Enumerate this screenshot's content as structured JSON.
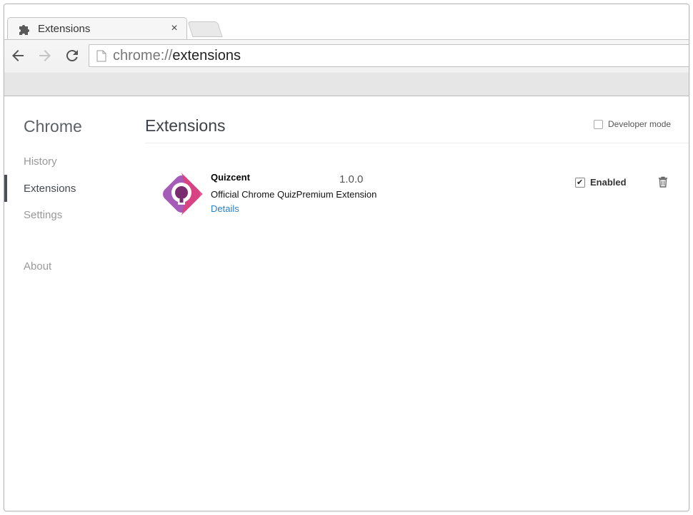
{
  "tab": {
    "title": "Extensions",
    "icon": "puzzle-icon",
    "close_label": "×"
  },
  "omnibox": {
    "scheme": "chrome://",
    "path": "extensions"
  },
  "sidebar": {
    "title": "Chrome",
    "items": [
      {
        "label": "History"
      },
      {
        "label": "Extensions",
        "selected": true
      },
      {
        "label": "Settings"
      },
      {
        "label": "About"
      }
    ]
  },
  "main": {
    "title": "Extensions",
    "developer_mode": {
      "label": "Developer mode",
      "checked": false
    }
  },
  "extension": {
    "name": "Quizcent",
    "version": "1.0.0",
    "description": "Official Chrome QuizPremium Extension",
    "details_link": "Details",
    "enabled_label": "Enabled",
    "enabled": true,
    "icon": "quizcent-logo",
    "logo_colors": [
      "#a55bb8",
      "#e0407a",
      "#7a2d6e"
    ]
  }
}
